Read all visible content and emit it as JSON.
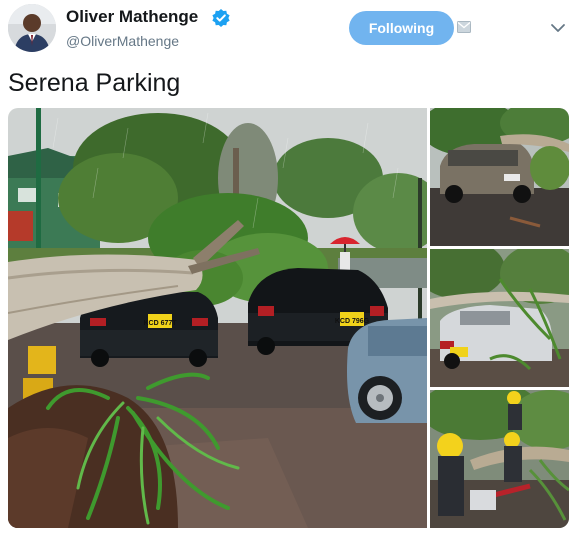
{
  "user": {
    "display_name": "Oliver Mathenge",
    "handle": "@OliverMathenge",
    "verified": true,
    "avatar_icon": "user-avatar"
  },
  "actions": {
    "follow_label": "Following",
    "follow_color": "#71b4ef",
    "dm_icon": "mail-icon",
    "menu_icon": "chevron-down-icon"
  },
  "tweet": {
    "text": "Serena Parking"
  },
  "media": {
    "count": 4,
    "photos": [
      {
        "name": "fallen tree on parked cars"
      },
      {
        "name": "suv under fallen branch"
      },
      {
        "name": "crushed white car"
      },
      {
        "name": "workers clearing tree"
      }
    ],
    "plates": [
      "KCD 677T",
      "KCD 796G"
    ]
  },
  "colors": {
    "text_primary": "#14171a",
    "text_secondary": "#657786",
    "verified_blue": "#1da1f2"
  }
}
